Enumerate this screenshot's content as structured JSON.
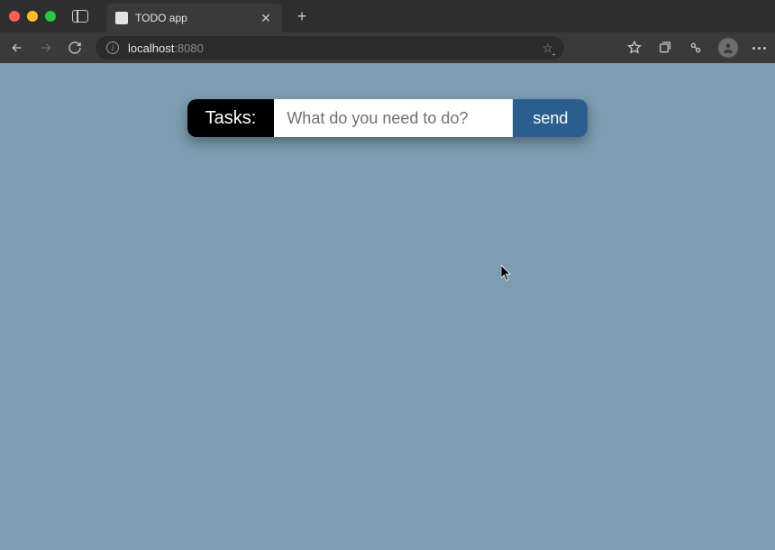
{
  "browser": {
    "tab_title": "TODO app",
    "url_host": "localhost",
    "url_port": ":8080"
  },
  "app": {
    "label": "Tasks:",
    "placeholder": "What do you need to do?",
    "send_label": "send"
  }
}
